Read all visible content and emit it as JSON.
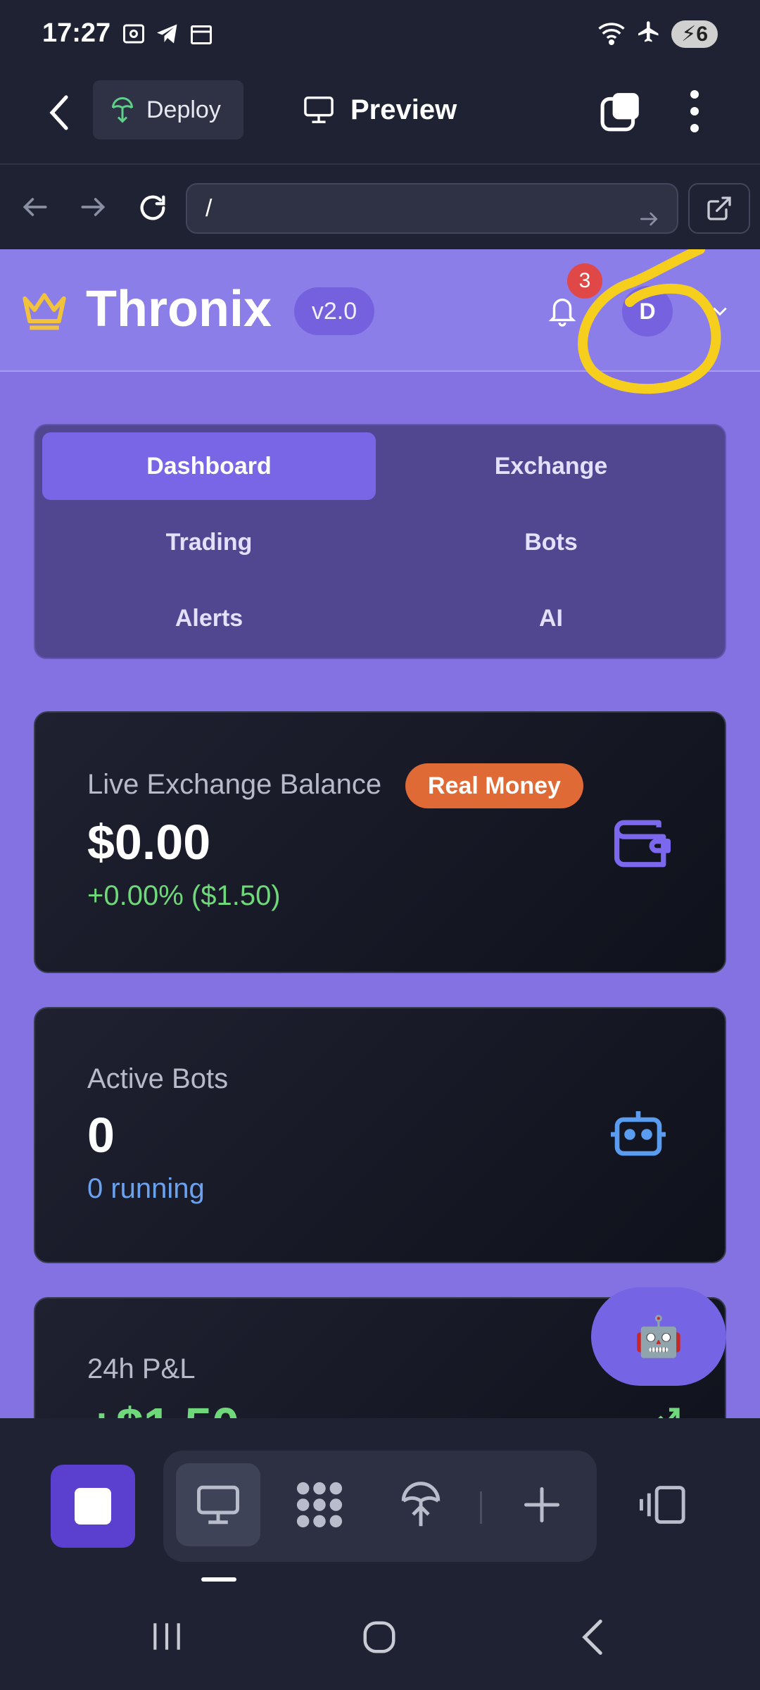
{
  "status_bar": {
    "time": "17:27",
    "battery": "6"
  },
  "toolbar": {
    "deploy_label": "Deploy",
    "preview_label": "Preview"
  },
  "url_bar": {
    "value": "/"
  },
  "app": {
    "brand": "Thronix",
    "version": "v2.0",
    "notifications_count": "3",
    "avatar_initial": "D"
  },
  "tabs": [
    {
      "label": "Dashboard",
      "active": true
    },
    {
      "label": "Exchange",
      "active": false
    },
    {
      "label": "Trading",
      "active": false
    },
    {
      "label": "Bots",
      "active": false
    },
    {
      "label": "Alerts",
      "active": false
    },
    {
      "label": "AI",
      "active": false
    }
  ],
  "cards": {
    "balance": {
      "label": "Live Exchange Balance",
      "badge": "Real Money",
      "value": "$0.00",
      "sub": "+0.00% ($1.50)"
    },
    "bots": {
      "label": "Active Bots",
      "value": "0",
      "sub": "0 running"
    },
    "pnl": {
      "label": "24h P&L",
      "value": "+$1.50"
    }
  },
  "colors": {
    "accent": "#7866e6",
    "app_bg": "#8572e2",
    "positive": "#6fd87a",
    "info": "#6aa2f0",
    "badge": "#e06a35"
  },
  "icons": [
    "chevron-left-icon",
    "deploy-icon",
    "monitor-icon",
    "tabs-icon",
    "more-vertical-icon",
    "arrow-left-icon",
    "arrow-right-icon",
    "reload-icon",
    "external-link-icon",
    "crown-icon",
    "bell-icon",
    "wallet-icon",
    "robot-icon",
    "trend-up-icon"
  ]
}
